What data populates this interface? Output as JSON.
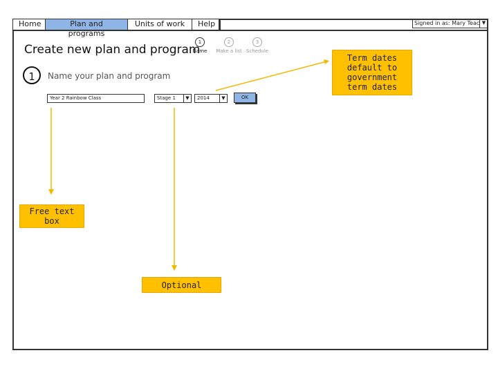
{
  "tabs": [
    {
      "label": "Home",
      "active": false
    },
    {
      "label": "Plan and programs",
      "active": true
    },
    {
      "label": "Units of work",
      "active": false
    },
    {
      "label": "Help",
      "active": false
    }
  ],
  "user": {
    "signed_in_text": "Signed in as: Mary Teacher",
    "dropdown_glyph": "▼"
  },
  "page": {
    "title": "Create new plan and program"
  },
  "steps": [
    {
      "number": "1",
      "label": "Name",
      "active": true
    },
    {
      "number": "2",
      "label": "Make a list",
      "active": false
    },
    {
      "number": "3",
      "label": "Schedule",
      "active": false
    }
  ],
  "section": {
    "number": "1",
    "title": "Name your plan and program"
  },
  "form": {
    "name_value": "Year 2 Rainbow Class",
    "stage_value": "Stage 1",
    "year_value": "2014",
    "ok_label": "OK"
  },
  "annotations": {
    "term_dates": "Term dates default to government term dates",
    "free_text": "Free text box",
    "optional": "Optional"
  },
  "colors": {
    "accent": "#8fb4e6",
    "note": "#ffc000",
    "arrow": "#f2b800"
  }
}
